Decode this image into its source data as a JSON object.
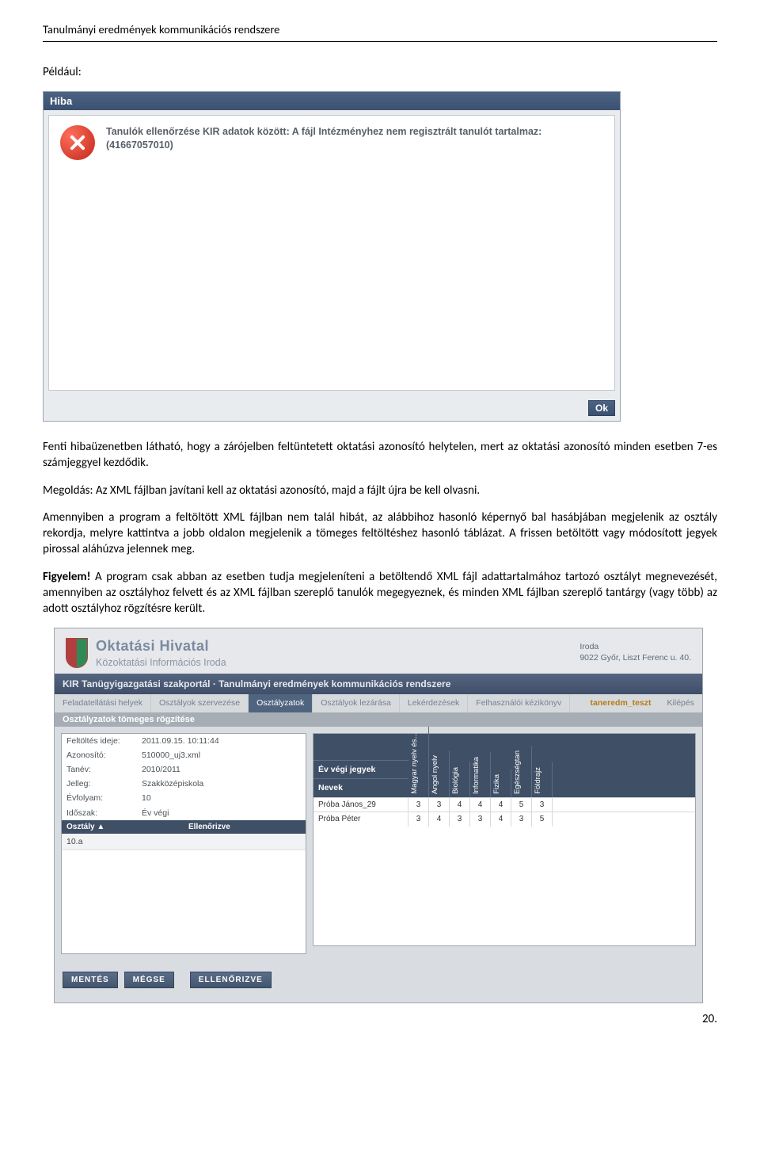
{
  "header": "Tanulmányi eredmények kommunikációs rendszere",
  "example_label": "Például:",
  "error_window": {
    "title": "Hiba",
    "message": "Tanulók ellenőrzése KIR adatok között: A fájl Intézményhez nem regisztrált tanulót tartalmaz: (41667057010)",
    "ok": "Ok"
  },
  "body": {
    "p1": "Fenti hibaüzenetben látható, hogy a zárójelben feltüntetett oktatási azonosító helytelen, mert az oktatási azonosító minden esetben 7-es számjeggyel kezdődik.",
    "p2": "Megoldás: Az XML fájlban javítani kell az oktatási azonosító, majd a fájlt újra be kell olvasni.",
    "p3": "Amennyiben a program a feltöltött XML fájlban nem talál hibát, az alábbihoz hasonló képernyő bal hasábjában megjelenik az osztály rekordja, melyre kattintva a jobb oldalon megjelenik a tömeges feltöltéshez hasonló táblázat. A frissen betöltött vagy módosított jegyek pirossal aláhúzva jelennek meg.",
    "p4a": "Figyelem!",
    "p4b": " A program csak abban az esetben tudja megjeleníteni a betöltendő XML fájl adattartalmához tartozó osztályt megnevezését, amennyiben az osztályhoz felvett és az XML fájlban szereplő tanulók megegyeznek, és minden XML fájlban szereplő tantárgy (vagy több) az adott osztályhoz rögzítésre került."
  },
  "portal": {
    "org_title": "Oktatási Hivatal",
    "org_sub": "Közoktatási Információs Iroda",
    "addr1": "Iroda",
    "addr2": "9022 Győr, Liszt Ferenc u. 40.",
    "breadcrumb": "KIR Tanügyigazgatási szakportál · Tanulmányi eredmények kommunikációs rendszere",
    "tabs": [
      "Feladatellátási helyek",
      "Osztályok szervezése",
      "Osztályzatok",
      "Osztályok lezárása",
      "Lekérdezések",
      "Felhasználói kézikönyv"
    ],
    "user": "taneredm_teszt",
    "logout": "Kilépés",
    "section_title": "Osztályzatok tömeges rögzítése",
    "info": {
      "rows": [
        [
          "Feltöltés ideje:",
          "2011.09.15. 10:11:44"
        ],
        [
          "Azonosító:",
          "510000_uj3.xml"
        ],
        [
          "Tanév:",
          "2010/2011"
        ],
        [
          "Jelleg:",
          "Szakközépiskola"
        ],
        [
          "Évfolyam:",
          "10"
        ],
        [
          "Időszak:",
          "Év végi"
        ]
      ],
      "class_hdr": [
        "Osztály ▲",
        "Ellenőrizve"
      ],
      "class_row": [
        "10.a",
        ""
      ]
    },
    "grades": {
      "corner_top": "Év végi jegyek",
      "corner_bottom": "Nevek",
      "subjects": [
        "Magyar nyelv és…",
        "Angol nyelv",
        "Biológia",
        "Informatika",
        "Fizika",
        "Egészségtan",
        "Földrajz"
      ],
      "rows": [
        {
          "name": "Próba János_29",
          "g": [
            "3",
            "3",
            "4",
            "4",
            "4",
            "5",
            "3"
          ]
        },
        {
          "name": "Próba Péter",
          "g": [
            "3",
            "4",
            "3",
            "3",
            "4",
            "3",
            "5"
          ]
        }
      ]
    },
    "buttons": {
      "save": "MENTÉS",
      "cancel": "MÉGSE",
      "checked": "ELLENŐRIZVE"
    }
  },
  "page_number": "20."
}
